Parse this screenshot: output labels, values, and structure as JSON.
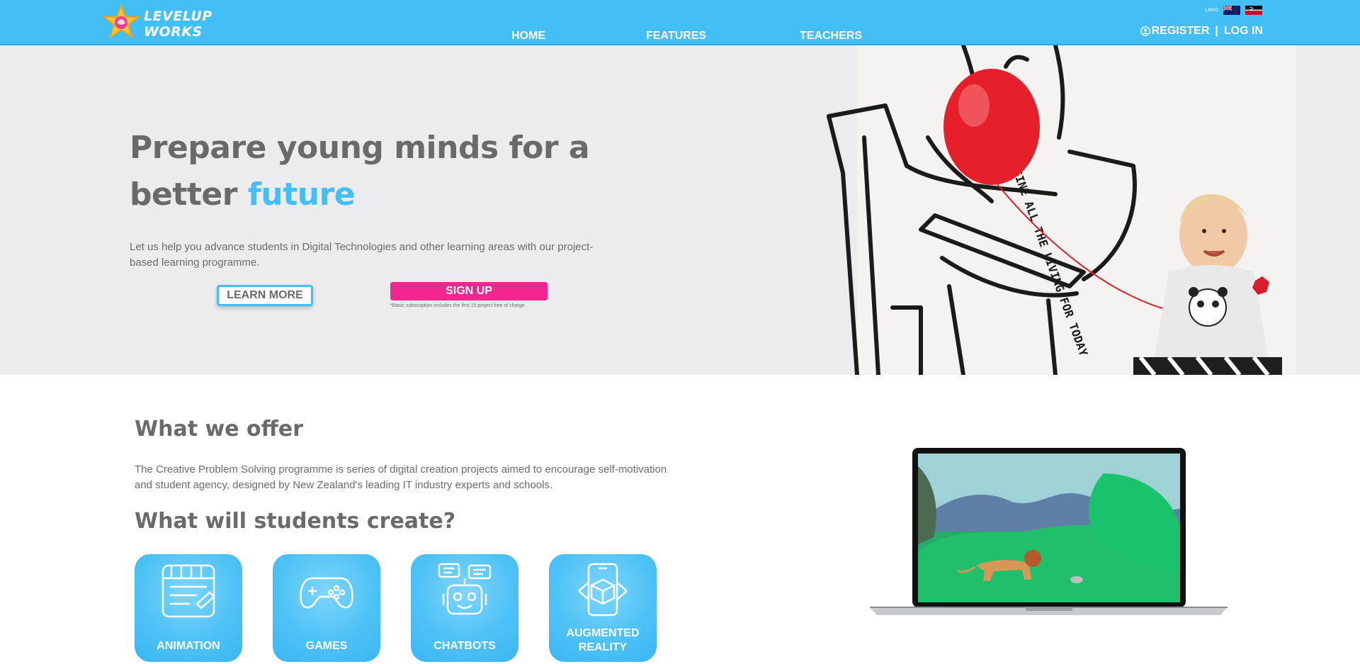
{
  "header": {
    "logo_line1": "LEVELUP",
    "logo_line2": "WORKS",
    "nav": [
      {
        "label": "HOME"
      },
      {
        "label": "FEATURES"
      },
      {
        "label": "TEACHERS"
      }
    ],
    "lang_label": "LANG",
    "register_label": "REGISTER",
    "separator": "|",
    "login_label": "LOG IN"
  },
  "hero": {
    "title_line1": "Prepare young minds for a",
    "title_line2_pre": "better ",
    "title_line2_accent": "future",
    "subtitle": "Let us help you advance students in Digital Technologies and other learning areas with our project-based learning programme.",
    "learn_more_label": "LEARN MORE",
    "signup_label": "SIGN UP",
    "signup_note": "*Basic subscription includes the first 15 project free of charge.",
    "book_text": "IMAGINE ALL THE LIVING FOR TODAY"
  },
  "offer": {
    "title": "What we offer",
    "text": "The Creative Problem Solving programme is series of digital creation projects aimed to encourage self-motivation and student agency, designed by New Zealand's leading IT industry experts and schools.",
    "create_title": "What will students create?"
  },
  "tiles": [
    {
      "label": "ANIMATION",
      "icon": "animation-icon"
    },
    {
      "label": "GAMES",
      "icon": "gamepad-icon"
    },
    {
      "label": "CHATBOTS",
      "icon": "robot-icon"
    },
    {
      "label": "AUGMENTED REALITY",
      "icon": "ar-phone-icon"
    }
  ],
  "colors": {
    "brand_blue": "#43bff5",
    "signup_pink": "#f2268f",
    "text_gray": "#6b6b6b"
  }
}
